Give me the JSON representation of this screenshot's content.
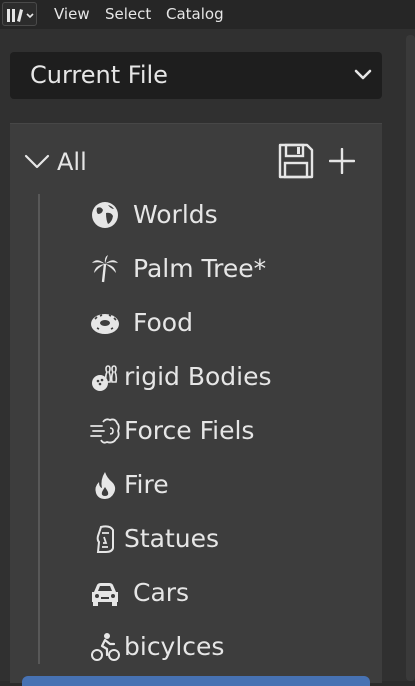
{
  "menu": {
    "view": "View",
    "select": "Select",
    "catalog": "Catalog"
  },
  "library": {
    "selected": "Current File"
  },
  "tree": {
    "root_label": "All",
    "items": [
      {
        "label": "Worlds",
        "icon": "globe-icon"
      },
      {
        "label": "Palm Tree*",
        "icon": "palm-tree-icon"
      },
      {
        "label": "Food",
        "icon": "donut-icon"
      },
      {
        "label": "rigid Bodies",
        "icon": "bowling-icon"
      },
      {
        "label": "Force Fiels",
        "icon": "wind-icon"
      },
      {
        "label": "Fire",
        "icon": "fire-icon"
      },
      {
        "label": "Statues",
        "icon": "moai-icon"
      },
      {
        "label": "Cars",
        "icon": "car-icon"
      },
      {
        "label": "bicylces",
        "icon": "cyclist-icon"
      }
    ]
  },
  "colors": {
    "selection": "#4772b3",
    "panel": "#3d3d3d",
    "background": "#303030"
  }
}
